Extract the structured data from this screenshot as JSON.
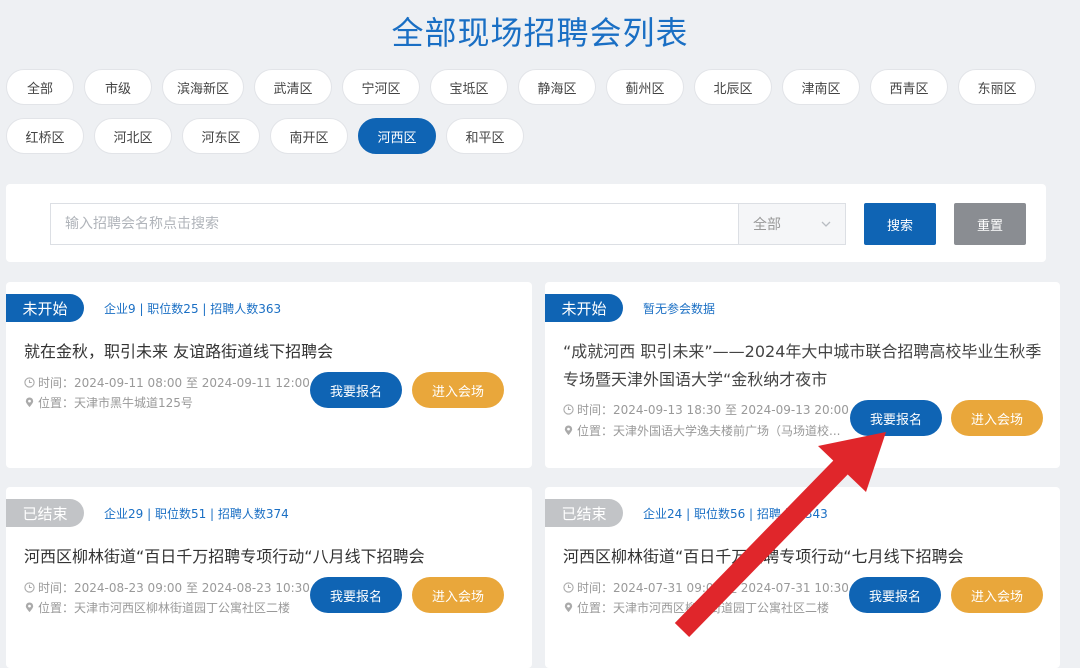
{
  "page": {
    "title": "全部现场招聘会列表"
  },
  "districts": {
    "row1": [
      "全部",
      "市级",
      "滨海新区",
      "武清区",
      "宁河区",
      "宝坻区",
      "静海区",
      "蓟州区",
      "北辰区",
      "津南区",
      "西青区",
      "东丽区"
    ],
    "row2": [
      "红桥区",
      "河北区",
      "河东区",
      "南开区",
      "河西区",
      "和平区"
    ],
    "selected": "河西区"
  },
  "search": {
    "placeholder": "输入招聘会名称点击搜索",
    "select_value": "全部",
    "search_label": "搜索",
    "reset_label": "重置"
  },
  "cards": [
    {
      "status": "未开始",
      "stats": "企业9 | 职位数25 | 招聘人数363",
      "title": "就在金秋，职引未来 友谊路街道线下招聘会",
      "time": "时间：2024-09-11 08:00 至 2024-09-11 12:00",
      "location": "位置：天津市黑牛城道125号",
      "signup_label": "我要报名",
      "enter_label": "进入会场"
    },
    {
      "status": "未开始",
      "stats": "暂无参会数据",
      "title": "“成就河西 职引未来”——2024年大中城市联合招聘高校毕业生秋季专场暨天津外国语大学“金秋纳才夜市",
      "time": "时间：2024-09-13 18:30 至 2024-09-13 20:00",
      "location": "位置：天津外国语大学逸夫楼前广场（马场道校...",
      "signup_label": "我要报名",
      "enter_label": "进入会场"
    },
    {
      "status": "已结束",
      "stats": "企业29 | 职位数51 | 招聘人数374",
      "title": "河西区柳林街道“百日千万招聘专项行动“八月线下招聘会",
      "time": "时间：2024-08-23 09:00 至 2024-08-23 10:30",
      "location": "位置：天津市河西区柳林街道园丁公寓社区二楼",
      "signup_label": "我要报名",
      "enter_label": "进入会场"
    },
    {
      "status": "已结束",
      "stats": "企业24 | 职位数56 | 招聘人数343",
      "title": "河西区柳林街道“百日千万招聘专项行动“七月线下招聘会",
      "time": "时间：2024-07-31 09:00 至 2024-07-31 10:30",
      "location": "位置：天津市河西区柳林街道园丁公寓社区二楼",
      "signup_label": "我要报名",
      "enter_label": "进入会场"
    }
  ],
  "colors": {
    "primary": "#0f64b4",
    "accent_orange": "#e9a73b",
    "badge_ended": "#c2c4c7",
    "annotation_arrow": "#e0262b"
  }
}
